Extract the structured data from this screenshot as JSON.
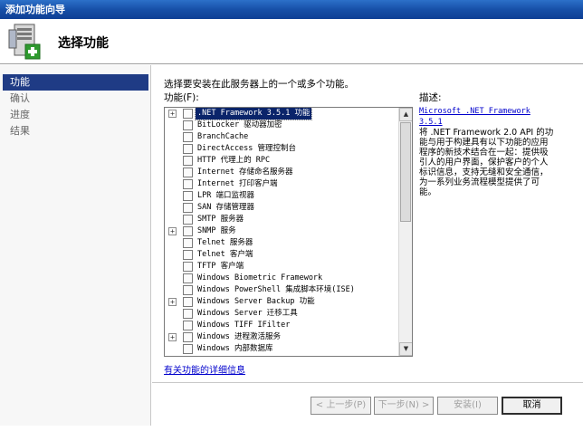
{
  "window": {
    "title": "添加功能向导"
  },
  "header": {
    "title": "选择功能",
    "icon": "server-add-icon"
  },
  "nav": {
    "items": [
      {
        "label": "功能",
        "active": true
      },
      {
        "label": "确认",
        "active": false
      },
      {
        "label": "进度",
        "active": false
      },
      {
        "label": "结果",
        "active": false
      }
    ]
  },
  "main": {
    "prompt": "选择要安装在此服务器上的一个或多个功能。",
    "list_label": "功能(F):",
    "features": [
      {
        "label": ".NET Framework 3.5.1 功能",
        "expandable": true,
        "checked": false,
        "selected": true
      },
      {
        "label": "BitLocker 驱动器加密",
        "expandable": false,
        "checked": false,
        "selected": false
      },
      {
        "label": "BranchCache",
        "expandable": false,
        "checked": false,
        "selected": false
      },
      {
        "label": "DirectAccess 管理控制台",
        "expandable": false,
        "checked": false,
        "selected": false
      },
      {
        "label": "HTTP 代理上的 RPC",
        "expandable": false,
        "checked": false,
        "selected": false
      },
      {
        "label": "Internet 存储命名服务器",
        "expandable": false,
        "checked": false,
        "selected": false
      },
      {
        "label": "Internet 打印客户端",
        "expandable": false,
        "checked": false,
        "selected": false
      },
      {
        "label": "LPR 端口监视器",
        "expandable": false,
        "checked": false,
        "selected": false
      },
      {
        "label": "SAN 存储管理器",
        "expandable": false,
        "checked": false,
        "selected": false
      },
      {
        "label": "SMTP 服务器",
        "expandable": false,
        "checked": false,
        "selected": false
      },
      {
        "label": "SNMP 服务",
        "expandable": true,
        "checked": false,
        "selected": false
      },
      {
        "label": "Telnet 服务器",
        "expandable": false,
        "checked": false,
        "selected": false
      },
      {
        "label": "Telnet 客户端",
        "expandable": false,
        "checked": false,
        "selected": false
      },
      {
        "label": "TFTP 客户端",
        "expandable": false,
        "checked": false,
        "selected": false
      },
      {
        "label": "Windows Biometric Framework",
        "expandable": false,
        "checked": false,
        "selected": false
      },
      {
        "label": "Windows PowerShell 集成脚本环境(ISE)",
        "expandable": false,
        "checked": false,
        "selected": false
      },
      {
        "label": "Windows Server Backup 功能",
        "expandable": true,
        "checked": false,
        "selected": false
      },
      {
        "label": "Windows Server 迁移工具",
        "expandable": false,
        "checked": false,
        "selected": false
      },
      {
        "label": "Windows TIFF IFilter",
        "expandable": false,
        "checked": false,
        "selected": false
      },
      {
        "label": "Windows 进程激活服务",
        "expandable": true,
        "checked": false,
        "selected": false
      },
      {
        "label": "Windows 内部数据库",
        "expandable": false,
        "checked": false,
        "selected": false
      }
    ],
    "description_label": "描述:",
    "description_link": "Microsoft .NET Framework 3.5.1",
    "description_text": "将 .NET Framework 2.0 API 的功能与用于构建具有以下功能的应用程序的新技术结合在一起：提供吸引人的用户界面，保护客户的个人标识信息，支持无缝和安全通信，为一系列业务流程模型提供了可能。",
    "more_info_link": "有关功能的详细信息"
  },
  "buttons": {
    "prev": "< 上一步(P)",
    "next": "下一步(N) >",
    "install": "安装(I)",
    "cancel": "取消"
  }
}
